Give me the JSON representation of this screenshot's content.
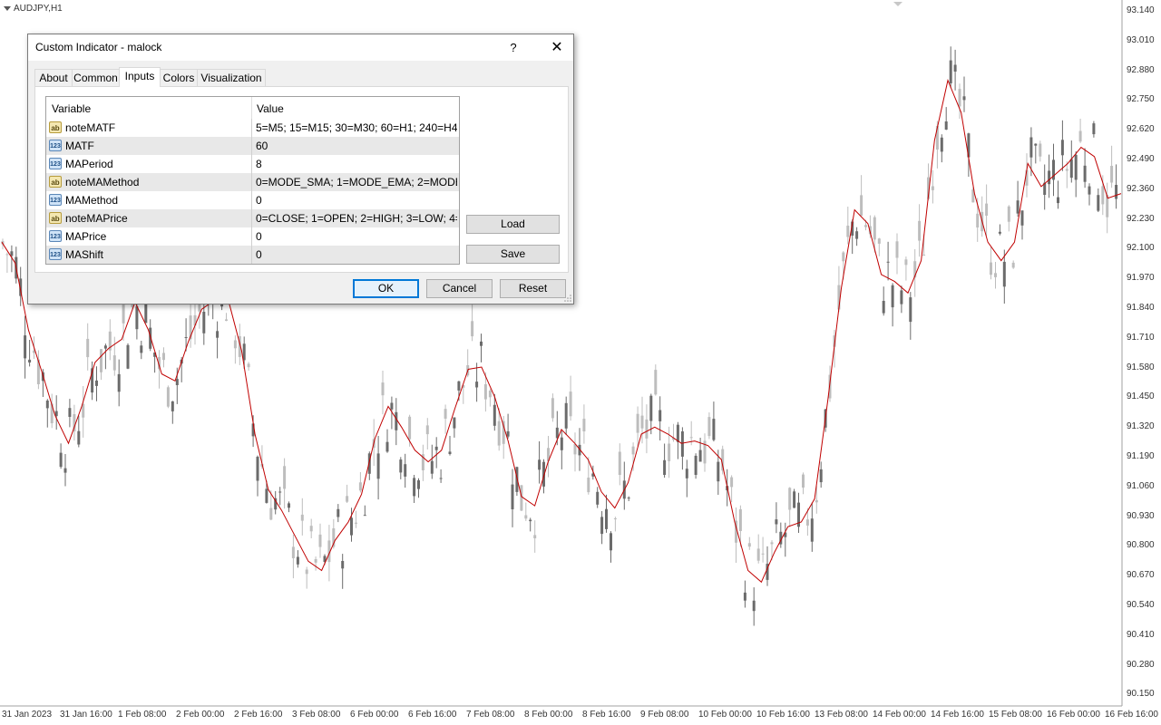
{
  "chart": {
    "symbol": "AUDJPY,H1",
    "colors": {
      "candle": "#6b6b6b",
      "candle_light": "#bdbdbd",
      "ma": "#c00000",
      "grid_axis": "#a0a0a0"
    },
    "price_axis": [
      "93.140",
      "93.010",
      "92.880",
      "92.750",
      "92.620",
      "92.490",
      "92.360",
      "92.230",
      "92.100",
      "91.970",
      "91.840",
      "91.710",
      "91.580",
      "91.450",
      "91.320",
      "91.190",
      "91.060",
      "90.930",
      "90.800",
      "90.670",
      "90.540",
      "90.410",
      "90.280",
      "90.150"
    ],
    "time_axis": [
      "31 Jan 2023",
      "31 Jan 16:00",
      "1 Feb 08:00",
      "2 Feb 00:00",
      "2 Feb 16:00",
      "3 Feb 08:00",
      "6 Feb 00:00",
      "6 Feb 16:00",
      "7 Feb 08:00",
      "8 Feb 00:00",
      "8 Feb 16:00",
      "9 Feb 08:00",
      "10 Feb 00:00",
      "10 Feb 16:00",
      "13 Feb 08:00",
      "14 Feb 00:00",
      "14 Feb 16:00",
      "15 Feb 08:00",
      "16 Feb 00:00",
      "16 Feb 16:00"
    ],
    "ma_path_prices": [
      92.14,
      92.05,
      91.76,
      91.58,
      91.39,
      91.27,
      91.43,
      91.62,
      91.68,
      91.72,
      91.88,
      91.76,
      91.57,
      91.54,
      91.71,
      91.85,
      91.89,
      91.89,
      91.67,
      91.31,
      91.07,
      90.98,
      90.87,
      90.76,
      90.72,
      90.85,
      90.93,
      91.05,
      91.29,
      91.43,
      91.34,
      91.24,
      91.19,
      91.24,
      91.42,
      91.59,
      91.6,
      91.47,
      91.28,
      91.04,
      91.0,
      91.19,
      91.33,
      91.27,
      91.2,
      91.06,
      90.99,
      91.1,
      91.31,
      91.34,
      91.31,
      91.27,
      91.28,
      91.26,
      91.2,
      90.93,
      90.72,
      90.67,
      90.8,
      90.91,
      90.93,
      91.03,
      91.46,
      91.94,
      92.28,
      92.22,
      92.0,
      91.97,
      91.92,
      92.06,
      92.58,
      92.84,
      92.7,
      92.35,
      92.14,
      92.06,
      92.14,
      92.48,
      92.38,
      92.43,
      92.48,
      92.55,
      92.51,
      92.33,
      92.35
    ]
  },
  "dialog": {
    "title": "Custom Indicator - malock",
    "help": "?",
    "close": "✕",
    "tabs": [
      "About",
      "Common",
      "Inputs",
      "Colors",
      "Visualization"
    ],
    "active_tab": "Inputs",
    "grid": {
      "headers": [
        "Variable",
        "Value"
      ],
      "rows": [
        {
          "type": "ab",
          "name": "noteMATF",
          "value": "5=M5; 15=M15; 30=M30; 60=H1; 240=H4; 1..."
        },
        {
          "type": "123",
          "name": "MATF",
          "value": "60"
        },
        {
          "type": "123",
          "name": "MAPeriod",
          "value": "8"
        },
        {
          "type": "ab",
          "name": "noteMAMethod",
          "value": "0=MODE_SMA; 1=MODE_EMA; 2=MODE_..."
        },
        {
          "type": "123",
          "name": "MAMethod",
          "value": "0"
        },
        {
          "type": "ab",
          "name": "noteMAPrice",
          "value": "0=CLOSE; 1=OPEN; 2=HIGH; 3=LOW; 4=M..."
        },
        {
          "type": "123",
          "name": "MAPrice",
          "value": "0"
        },
        {
          "type": "123",
          "name": "MAShift",
          "value": "0"
        }
      ]
    },
    "buttons": {
      "load": "Load",
      "save": "Save",
      "ok": "OK",
      "cancel": "Cancel",
      "reset": "Reset"
    }
  }
}
